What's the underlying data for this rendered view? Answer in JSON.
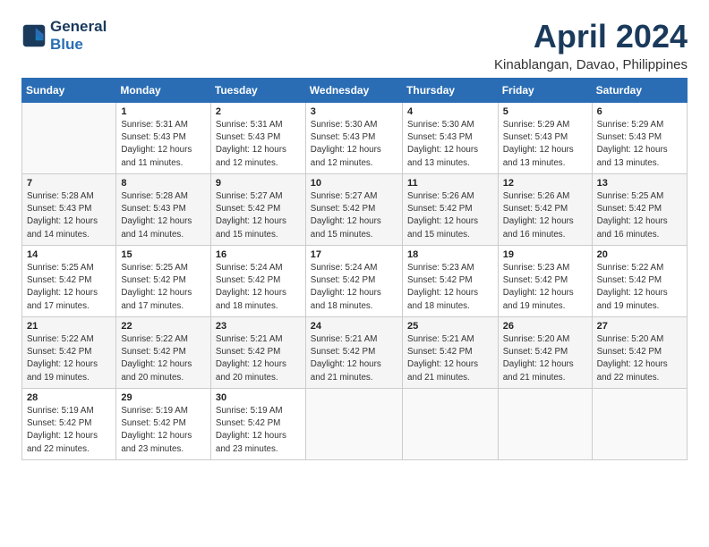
{
  "header": {
    "logo_line1": "General",
    "logo_line2": "Blue",
    "month_title": "April 2024",
    "subtitle": "Kinablangan, Davao, Philippines"
  },
  "days_of_week": [
    "Sunday",
    "Monday",
    "Tuesday",
    "Wednesday",
    "Thursday",
    "Friday",
    "Saturday"
  ],
  "weeks": [
    [
      {
        "day": "",
        "info": ""
      },
      {
        "day": "1",
        "info": "Sunrise: 5:31 AM\nSunset: 5:43 PM\nDaylight: 12 hours\nand 11 minutes."
      },
      {
        "day": "2",
        "info": "Sunrise: 5:31 AM\nSunset: 5:43 PM\nDaylight: 12 hours\nand 12 minutes."
      },
      {
        "day": "3",
        "info": "Sunrise: 5:30 AM\nSunset: 5:43 PM\nDaylight: 12 hours\nand 12 minutes."
      },
      {
        "day": "4",
        "info": "Sunrise: 5:30 AM\nSunset: 5:43 PM\nDaylight: 12 hours\nand 13 minutes."
      },
      {
        "day": "5",
        "info": "Sunrise: 5:29 AM\nSunset: 5:43 PM\nDaylight: 12 hours\nand 13 minutes."
      },
      {
        "day": "6",
        "info": "Sunrise: 5:29 AM\nSunset: 5:43 PM\nDaylight: 12 hours\nand 13 minutes."
      }
    ],
    [
      {
        "day": "7",
        "info": "Sunrise: 5:28 AM\nSunset: 5:43 PM\nDaylight: 12 hours\nand 14 minutes."
      },
      {
        "day": "8",
        "info": "Sunrise: 5:28 AM\nSunset: 5:43 PM\nDaylight: 12 hours\nand 14 minutes."
      },
      {
        "day": "9",
        "info": "Sunrise: 5:27 AM\nSunset: 5:42 PM\nDaylight: 12 hours\nand 15 minutes."
      },
      {
        "day": "10",
        "info": "Sunrise: 5:27 AM\nSunset: 5:42 PM\nDaylight: 12 hours\nand 15 minutes."
      },
      {
        "day": "11",
        "info": "Sunrise: 5:26 AM\nSunset: 5:42 PM\nDaylight: 12 hours\nand 15 minutes."
      },
      {
        "day": "12",
        "info": "Sunrise: 5:26 AM\nSunset: 5:42 PM\nDaylight: 12 hours\nand 16 minutes."
      },
      {
        "day": "13",
        "info": "Sunrise: 5:25 AM\nSunset: 5:42 PM\nDaylight: 12 hours\nand 16 minutes."
      }
    ],
    [
      {
        "day": "14",
        "info": "Sunrise: 5:25 AM\nSunset: 5:42 PM\nDaylight: 12 hours\nand 17 minutes."
      },
      {
        "day": "15",
        "info": "Sunrise: 5:25 AM\nSunset: 5:42 PM\nDaylight: 12 hours\nand 17 minutes."
      },
      {
        "day": "16",
        "info": "Sunrise: 5:24 AM\nSunset: 5:42 PM\nDaylight: 12 hours\nand 18 minutes."
      },
      {
        "day": "17",
        "info": "Sunrise: 5:24 AM\nSunset: 5:42 PM\nDaylight: 12 hours\nand 18 minutes."
      },
      {
        "day": "18",
        "info": "Sunrise: 5:23 AM\nSunset: 5:42 PM\nDaylight: 12 hours\nand 18 minutes."
      },
      {
        "day": "19",
        "info": "Sunrise: 5:23 AM\nSunset: 5:42 PM\nDaylight: 12 hours\nand 19 minutes."
      },
      {
        "day": "20",
        "info": "Sunrise: 5:22 AM\nSunset: 5:42 PM\nDaylight: 12 hours\nand 19 minutes."
      }
    ],
    [
      {
        "day": "21",
        "info": "Sunrise: 5:22 AM\nSunset: 5:42 PM\nDaylight: 12 hours\nand 19 minutes."
      },
      {
        "day": "22",
        "info": "Sunrise: 5:22 AM\nSunset: 5:42 PM\nDaylight: 12 hours\nand 20 minutes."
      },
      {
        "day": "23",
        "info": "Sunrise: 5:21 AM\nSunset: 5:42 PM\nDaylight: 12 hours\nand 20 minutes."
      },
      {
        "day": "24",
        "info": "Sunrise: 5:21 AM\nSunset: 5:42 PM\nDaylight: 12 hours\nand 21 minutes."
      },
      {
        "day": "25",
        "info": "Sunrise: 5:21 AM\nSunset: 5:42 PM\nDaylight: 12 hours\nand 21 minutes."
      },
      {
        "day": "26",
        "info": "Sunrise: 5:20 AM\nSunset: 5:42 PM\nDaylight: 12 hours\nand 21 minutes."
      },
      {
        "day": "27",
        "info": "Sunrise: 5:20 AM\nSunset: 5:42 PM\nDaylight: 12 hours\nand 22 minutes."
      }
    ],
    [
      {
        "day": "28",
        "info": "Sunrise: 5:19 AM\nSunset: 5:42 PM\nDaylight: 12 hours\nand 22 minutes."
      },
      {
        "day": "29",
        "info": "Sunrise: 5:19 AM\nSunset: 5:42 PM\nDaylight: 12 hours\nand 23 minutes."
      },
      {
        "day": "30",
        "info": "Sunrise: 5:19 AM\nSunset: 5:42 PM\nDaylight: 12 hours\nand 23 minutes."
      },
      {
        "day": "",
        "info": ""
      },
      {
        "day": "",
        "info": ""
      },
      {
        "day": "",
        "info": ""
      },
      {
        "day": "",
        "info": ""
      }
    ]
  ]
}
